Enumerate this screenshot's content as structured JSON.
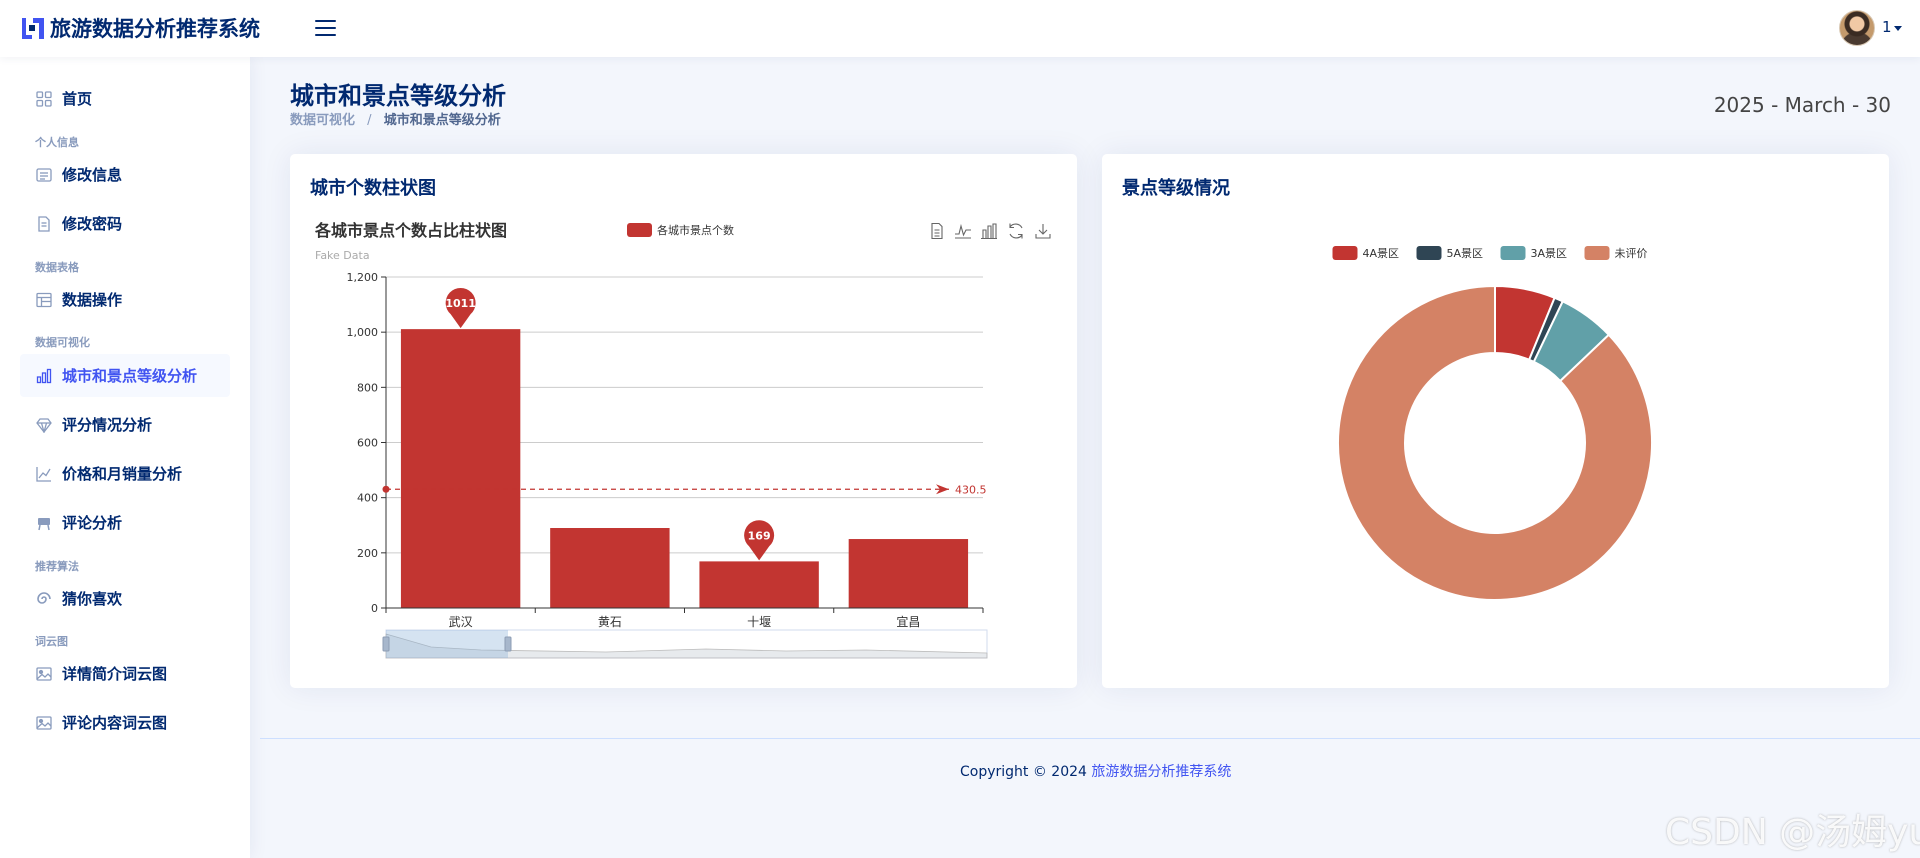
{
  "app": {
    "title": "旅游数据分析推荐系统"
  },
  "header": {
    "username": "1",
    "menu_icon": "hamburger-icon",
    "avatar": "user-avatar"
  },
  "sidebar": {
    "items": [
      {
        "type": "item",
        "label": "首页",
        "icon": "grid-icon"
      },
      {
        "type": "heading",
        "label": "个人信息"
      },
      {
        "type": "item",
        "label": "修改信息",
        "icon": "card-list-icon"
      },
      {
        "type": "item",
        "label": "修改密码",
        "icon": "document-icon"
      },
      {
        "type": "heading",
        "label": "数据表格"
      },
      {
        "type": "item",
        "label": "数据操作",
        "icon": "table-icon"
      },
      {
        "type": "heading",
        "label": "数据可视化"
      },
      {
        "type": "item",
        "label": "城市和景点等级分析",
        "icon": "bar-chart-icon",
        "active": true
      },
      {
        "type": "item",
        "label": "评分情况分析",
        "icon": "gem-icon"
      },
      {
        "type": "item",
        "label": "价格和月销量分析",
        "icon": "line-chart-icon"
      },
      {
        "type": "item",
        "label": "评论分析",
        "icon": "easel-icon"
      },
      {
        "type": "heading",
        "label": "推荐算法"
      },
      {
        "type": "item",
        "label": "猜你喜欢",
        "icon": "swirl-icon"
      },
      {
        "type": "heading",
        "label": "词云图"
      },
      {
        "type": "item",
        "label": "详情简介词云图",
        "icon": "image-icon"
      },
      {
        "type": "item",
        "label": "评论内容词云图",
        "icon": "images-icon"
      }
    ]
  },
  "page": {
    "title": "城市和景点等级分析",
    "breadcrumb": {
      "parent": "数据可视化",
      "separator": "/",
      "current": "城市和景点等级分析"
    },
    "date": "2025 - March - 30"
  },
  "cards": {
    "bar": {
      "title": "城市个数柱状图",
      "toolbar_icons": [
        "data-view-icon",
        "line-switch-icon",
        "bar-switch-icon",
        "restore-icon",
        "save-image-icon"
      ]
    },
    "pie": {
      "title": "景点等级情况"
    }
  },
  "chart_data": [
    {
      "type": "bar",
      "title": "各城市景点个数占比柱状图",
      "subtitle": "Fake Data",
      "legend": [
        "各城市景点个数"
      ],
      "categories": [
        "武汉",
        "黄石",
        "十堰",
        "宜昌"
      ],
      "series": [
        {
          "name": "各城市景点个数",
          "values": [
            1011,
            290,
            169,
            250
          ],
          "color": "#c23531"
        }
      ],
      "ylim": [
        0,
        1200
      ],
      "yticks": [
        "0",
        "200",
        "400",
        "600",
        "800",
        "1,000",
        "1,200"
      ],
      "mark_points": [
        {
          "category": "武汉",
          "value": 1011,
          "label": "1011"
        },
        {
          "category": "十堰",
          "value": 169,
          "label": "169"
        }
      ],
      "mark_line": {
        "value": 430.5,
        "label": "430.5"
      },
      "grid": true,
      "datazoom": true
    },
    {
      "type": "pie",
      "donut": true,
      "legend_position": "top",
      "slices": [
        {
          "label": "4A景区",
          "value": 6.2,
          "color": "#c23531"
        },
        {
          "label": "5A景区",
          "value": 0.9,
          "color": "#2f4554"
        },
        {
          "label": "3A景区",
          "value": 5.8,
          "color": "#61a0a8"
        },
        {
          "label": "未评价",
          "value": 87.1,
          "color": "#d48265"
        }
      ]
    }
  ],
  "footer": {
    "copyright": "Copyright © 2024",
    "link": "旅游数据分析推荐系统"
  },
  "watermark": "CSDN @汤姆yu"
}
